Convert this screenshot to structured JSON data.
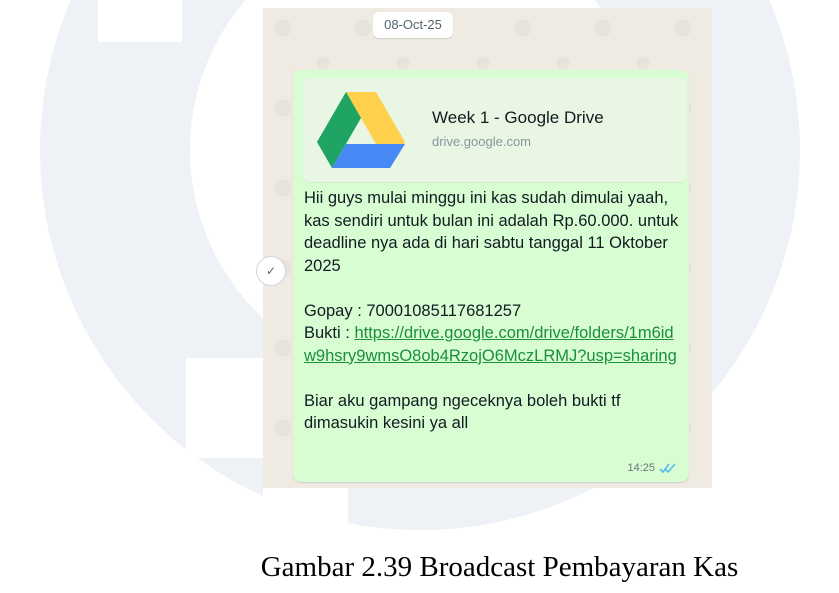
{
  "chat": {
    "date_chip": "08-Oct-25",
    "link_preview": {
      "title": "Week 1 - Google Drive",
      "domain": "drive.google.com",
      "icon": "google-drive-icon"
    },
    "message": {
      "line1": "Hii guys mulai minggu ini kas sudah dimulai yaah, kas sendiri untuk bulan ini adalah Rp.60.000. untuk deadline nya ada di hari sabtu tanggal 11 Oktober 2025",
      "gopay": "Gopay : 70001085117681257",
      "bukti_label": "Bukti : ",
      "bukti_link": "https://drive.google.com/drive/folders/1m6idw9hsry9wmsO8ob4RzojO6MczLRMJ?usp=sharing",
      "closing": "Biar aku gampang ngeceknya boleh bukti tf dimasukin kesini ya all"
    },
    "time": "14:25",
    "read_status_icon": "double-check-read-icon",
    "side_button_icon": "reaction-icon"
  },
  "caption": "Gambar 2.39 Broadcast Pembayaran Kas",
  "colors": {
    "bubble": "#d9fdd3",
    "chat_background": "#efeae2",
    "link": "#1a8f3c",
    "read_ticks": "#53bdeb",
    "drive_green": "#1fa463",
    "drive_yellow": "#ffd04b",
    "drive_blue": "#4688f4"
  }
}
